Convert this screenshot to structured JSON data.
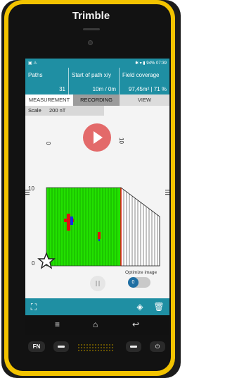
{
  "device": {
    "brand": "Trimble"
  },
  "statusbar": {
    "left_icons": "▣ ⚠",
    "time": "07:39",
    "battery": "94%",
    "right_icons": "✱ ▾ ▮"
  },
  "info": {
    "paths_label": "Paths",
    "paths_value": "31",
    "start_label": "Start of path x/y",
    "start_value": "10m / 0m",
    "coverage_label": "Field coverage",
    "coverage_value": "97,45m² | 71 %"
  },
  "tabs": [
    {
      "label": "MEASUREMENT"
    },
    {
      "label": "RECORDING"
    },
    {
      "label": "VIEW"
    }
  ],
  "scale": {
    "label": "Scale",
    "value": "200 nT"
  },
  "plot": {
    "x_tick_left": "0",
    "x_tick_right": "10",
    "y_tick_top": "10",
    "y_tick_bottom": "0"
  },
  "controls": {
    "optimize_label": "Optimize image",
    "toggle_state": "0"
  },
  "colors": {
    "accent": "#1f8fa3",
    "play": "#e36a6a",
    "field_green": "#22e000",
    "anomaly_red": "#e01010",
    "anomaly_blue": "#1030e0",
    "device_yellow": "#f2c300"
  },
  "keys": {
    "fn": "FN"
  }
}
